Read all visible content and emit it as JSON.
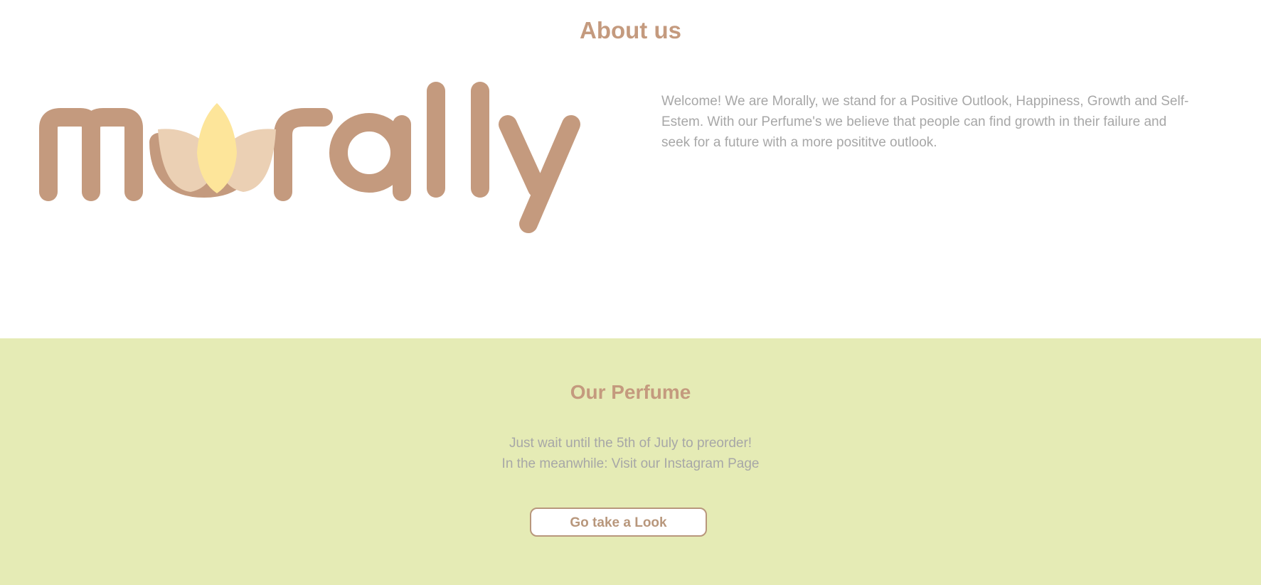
{
  "about": {
    "title": "About us",
    "logo_text": "morally",
    "description": "Welcome! We are Morally, we stand for a Positive Outlook, Happiness, Growth and Self-Estem. With our Perfume's we believe that people can find growth in their failure and seek for a future with a more posititve outlook."
  },
  "perfume": {
    "title": "Our Perfume",
    "line1": "Just wait until the 5th of July to preorder!",
    "line2": "In the meanwhile: Visit our Instagram Page",
    "button_label": "Go take a Look"
  },
  "colors": {
    "brand_brown": "#c49a7e",
    "petal_light": "#ebd0b4",
    "petal_center": "#fde59a",
    "section_green": "#e5ebb5",
    "body_text": "#a7a7a7"
  },
  "icons": {
    "logo": "morally-lotus-logo"
  }
}
